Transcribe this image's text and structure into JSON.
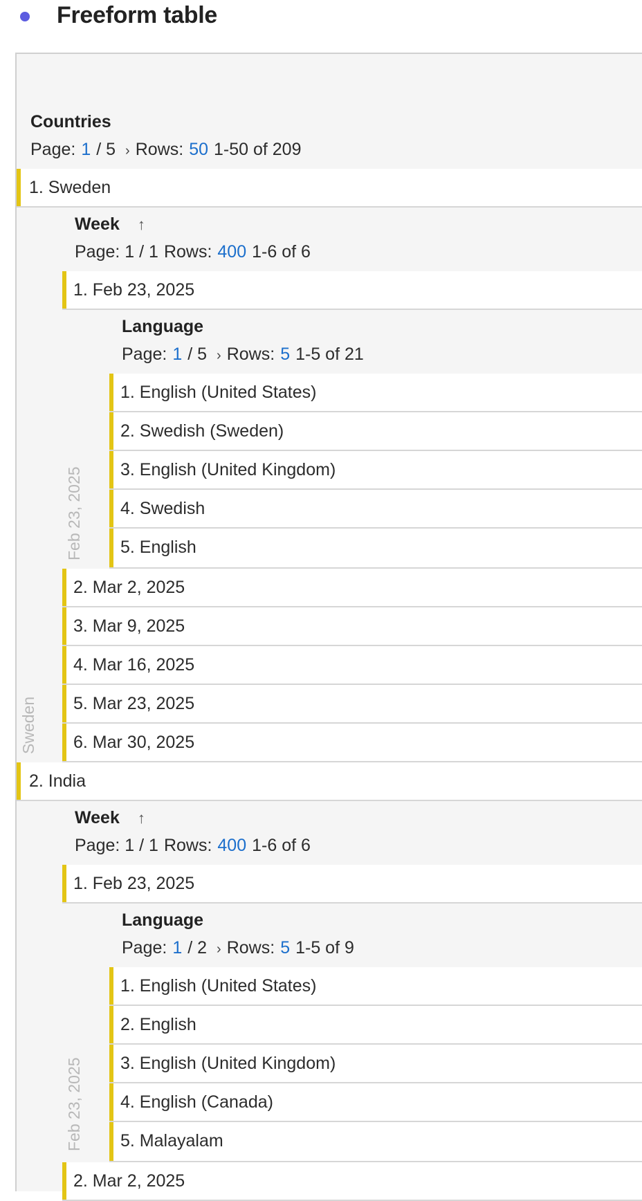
{
  "page": {
    "title": "Freeform table"
  },
  "countries": {
    "title": "Countries",
    "page_label": "Page:",
    "page_current": "1",
    "page_total": "/ 5",
    "rows_label": "Rows:",
    "rows_value": "50",
    "range": "1-50 of 209",
    "items": [
      "1.  Sweden",
      "2.  India"
    ]
  },
  "sweden": {
    "week": {
      "title": "Week",
      "page_text": "Page: 1 / 1",
      "rows_label": "Rows:",
      "rows_value": "400",
      "range": "1-6 of 6",
      "items": [
        "1.  Feb 23, 2025",
        "2.  Mar 2, 2025",
        "3.  Mar 9, 2025",
        "4.  Mar 16, 2025",
        "5.  Mar 23, 2025",
        "6.  Mar 30, 2025"
      ]
    },
    "language": {
      "title": "Language",
      "page_label": "Page:",
      "page_current": "1",
      "page_total": "/ 5",
      "rows_label": "Rows:",
      "rows_value": "5",
      "range": "1-5 of 21",
      "items": [
        "1.  English (United States)",
        "2.  Swedish (Sweden)",
        "3.  English (United Kingdom)",
        "4.  Swedish",
        "5.  English"
      ]
    },
    "vlabel_country": "Sweden",
    "vlabel_week": "Feb 23, 2025"
  },
  "india": {
    "week": {
      "title": "Week",
      "page_text": "Page: 1 / 1",
      "rows_label": "Rows:",
      "rows_value": "400",
      "range": "1-6 of 6",
      "items": [
        "1.  Feb 23, 2025",
        "2.  Mar 2, 2025"
      ]
    },
    "language": {
      "title": "Language",
      "page_label": "Page:",
      "page_current": "1",
      "page_total": "/ 2",
      "rows_label": "Rows:",
      "rows_value": "5",
      "range": "1-5 of 9",
      "items": [
        "1.  English (United States)",
        "2.  English",
        "3.  English (United Kingdom)",
        "4.  English (Canada)",
        "5.  Malayalam"
      ]
    },
    "vlabel_week": "Feb 23, 2025"
  },
  "icons": {
    "sort": "arrow-up-icon",
    "next_page": "chevron-right-icon",
    "bullet": "dot-icon"
  },
  "colors": {
    "accent_bar": "#e3c515",
    "link": "#1c6fcc",
    "bullet": "#5c5ce0"
  }
}
